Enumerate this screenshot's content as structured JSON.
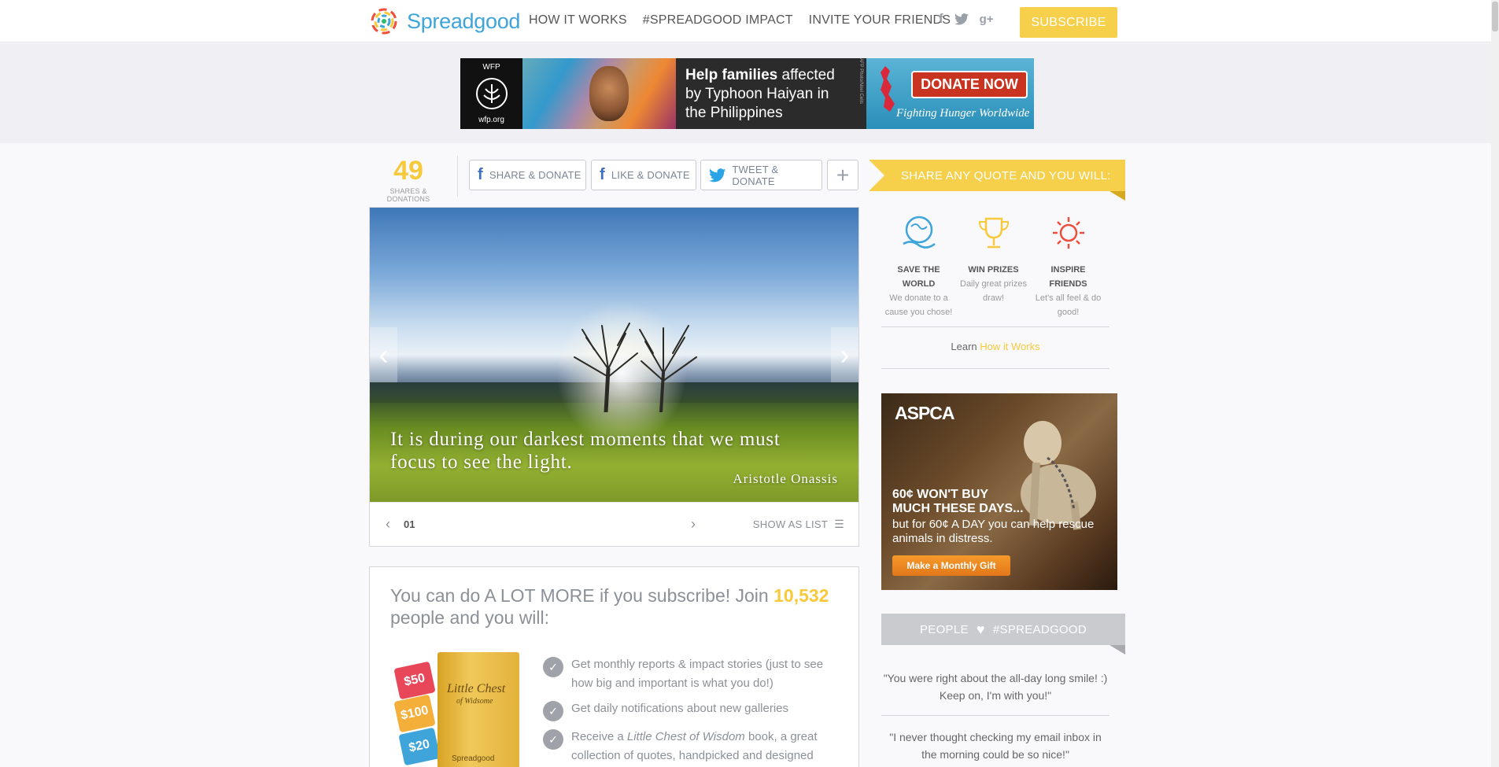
{
  "header": {
    "logo_text": "Spreadgood",
    "nav": [
      "HOW IT WORKS",
      "#SPREADGOOD IMPACT",
      "INVITE YOUR FRIENDS"
    ],
    "social_icons": [
      "facebook-icon",
      "twitter-icon",
      "google-plus-icon"
    ],
    "subscribe_label": "SUBSCRIBE"
  },
  "top_ad": {
    "wfp_label": "WFP",
    "wfp_site": "wfp.org",
    "headline_bold": "Help families",
    "headline_rest": " affected by Typhoon Haiyan in the Philippines",
    "credit": "AFP Photo/Noel Celis",
    "donate_label": "DONATE NOW",
    "tagline": "Fighting Hunger Worldwide"
  },
  "share_bar": {
    "count": "49",
    "count_label": "SHARES & DONATIONS",
    "share_label": "SHARE & DONATE",
    "like_label": "LIKE & DONATE",
    "tweet_label": "TWEET & DONATE",
    "plus_label": "+"
  },
  "gallery": {
    "quote": "It is during our darkest moments that we must focus to see the light.",
    "author": "Aristotle Onassis",
    "page_number": "01",
    "show_as_list": "SHOW AS LIST"
  },
  "promo": {
    "title_before": "You can do A LOT MORE if you subscribe! Join ",
    "subscriber_count": "10,532",
    "title_after": " people and you will:",
    "tags": [
      "$50",
      "$100",
      "$20"
    ],
    "book_title": "Little Chest",
    "book_subtitle": "of Widsome",
    "book_brand": "Spreadgood",
    "benefit_1": "Get monthly reports & impact stories (just to see how big and important is what you do!)",
    "benefit_2": "Get daily notifications about new galleries",
    "benefit_3_before": "Receive a ",
    "benefit_3_italic": "Little Chest of Wisdom",
    "benefit_3_after": " book, a great collection of quotes, handpicked and designed"
  },
  "sidebar": {
    "ribbon": "SHARE ANY QUOTE AND YOU WILL:",
    "benefits": [
      {
        "title": "SAVE THE WORLD",
        "desc": "We donate to a cause you chose!"
      },
      {
        "title": "WIN PRIZES",
        "desc": "Daily great prizes draw!"
      },
      {
        "title": "INSPIRE FRIENDS",
        "desc": "Let's all feel & do good!"
      }
    ],
    "learn_prefix": "Learn ",
    "learn_link": "How it Works",
    "aspca": {
      "logo": "ASPCA",
      "headline_1": "60¢ WON'T BUY",
      "headline_2": "MUCH THESE DAYS...",
      "body": "but for 60¢ A DAY you can help rescue animals in distress.",
      "button": "Make a Monthly Gift"
    },
    "people_left": "PEOPLE",
    "people_right": "#SPREADGOOD",
    "testimonials": [
      "\"You were right about the all-day long smile! :) Keep on, I'm with you!\"",
      "\"I never thought checking my email inbox in the morning could be so nice!\""
    ]
  },
  "colors": {
    "accent_yellow": "#f7d04b",
    "brand_blue": "#3ea4d9",
    "donate_red": "#c8341f"
  }
}
